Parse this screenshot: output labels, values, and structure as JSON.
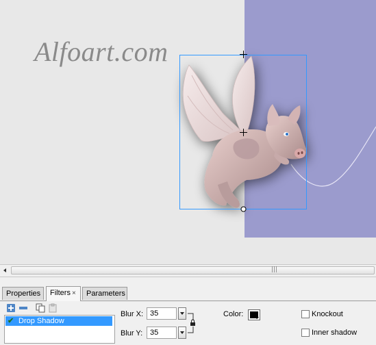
{
  "canvas": {
    "watermark": "Alfoart.com",
    "colors": {
      "stage_bg": "#e8e8e8",
      "accent_rect": "#9b9bcd",
      "selection": "#3399ff"
    }
  },
  "panel": {
    "tabs": [
      {
        "label": "Properties",
        "active": false
      },
      {
        "label": "Filters",
        "active": true,
        "close": "×"
      },
      {
        "label": "Parameters",
        "active": false
      }
    ],
    "toolbar_icons": [
      "add-filter-icon",
      "remove-filter-icon",
      "copy-filter-icon",
      "paste-filter-icon"
    ],
    "filters": [
      {
        "label": "Drop Shadow",
        "enabled": true,
        "selected": true
      }
    ],
    "blur_x": {
      "label": "Blur X:",
      "value": "35"
    },
    "blur_y": {
      "label": "Blur Y:",
      "value": "35"
    },
    "color": {
      "label": "Color:",
      "value": "#000000"
    },
    "knockout": {
      "label": "Knockout",
      "checked": false
    },
    "inner_shadow": {
      "label": "Inner shadow",
      "checked": false
    }
  }
}
